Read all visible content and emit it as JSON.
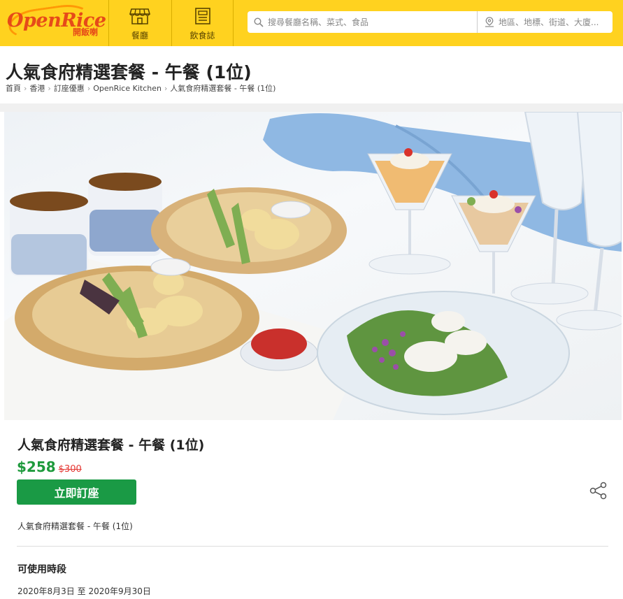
{
  "header": {
    "logo_text": "OpenRice",
    "logo_subtext": "開飯喇",
    "nav": [
      {
        "label": "餐廳",
        "icon": "storefront-icon"
      },
      {
        "label": "飲食誌",
        "icon": "magazine-icon"
      }
    ],
    "search": {
      "keyword_placeholder": "搜尋餐廳名稱、菜式、食品",
      "location_placeholder": "地區、地標、街道、大廈..."
    }
  },
  "page": {
    "title": "人氣食府精選套餐 - 午餐 (1位)",
    "breadcrumb": [
      "首頁",
      "香港",
      "訂座優惠",
      "OpenRice Kitchen",
      "人氣食府精選套餐 - 午餐 (1位)"
    ]
  },
  "deal": {
    "title": "人氣食府精選套餐 - 午餐 (1位)",
    "price": "$258",
    "original_price": "$300",
    "book_label": "立即訂座",
    "description": "人氣食府精選套餐 - 午餐 (1位)",
    "availability_heading": "可使用時段",
    "availability_period": "2020年8月3日 至 2020年9月30日"
  },
  "colors": {
    "header_bg": "#ffd21f",
    "price_green": "#1e9a3c",
    "strike_red": "#e53935",
    "button_green": "#1a9a45"
  }
}
